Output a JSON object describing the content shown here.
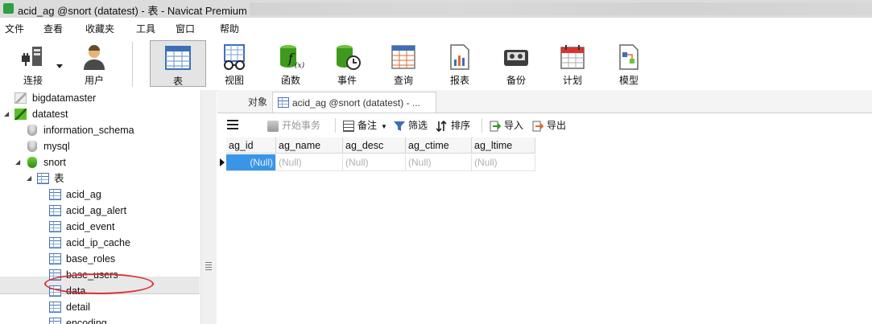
{
  "window": {
    "title": "acid_ag @snort (datatest) - 表 - Navicat Premium"
  },
  "menu": [
    "文件",
    "查看",
    "收藏夹",
    "工具",
    "窗口",
    "帮助"
  ],
  "toolbar": {
    "buttons": [
      {
        "label": "连接",
        "icon": "plug-icon"
      },
      {
        "label": "用户",
        "icon": "user-icon"
      },
      {
        "label": "表",
        "icon": "table-icon",
        "active": true
      },
      {
        "label": "视图",
        "icon": "view-icon"
      },
      {
        "label": "函数",
        "icon": "function-icon"
      },
      {
        "label": "事件",
        "icon": "event-icon"
      },
      {
        "label": "查询",
        "icon": "query-icon"
      },
      {
        "label": "报表",
        "icon": "report-icon"
      },
      {
        "label": "备份",
        "icon": "backup-icon"
      },
      {
        "label": "计划",
        "icon": "schedule-icon"
      },
      {
        "label": "模型",
        "icon": "model-icon"
      }
    ]
  },
  "sidebar": {
    "connections": [
      {
        "name": "bigdatamaster"
      },
      {
        "name": "datatest",
        "databases": [
          {
            "name": "information_schema"
          },
          {
            "name": "mysql"
          },
          {
            "name": "snort",
            "group": "表",
            "tables": [
              "acid_ag",
              "acid_ag_alert",
              "acid_event",
              "acid_ip_cache",
              "base_roles",
              "base_users",
              "data",
              "detail",
              "encoding"
            ]
          }
        ]
      }
    ],
    "selected": "acid_ag"
  },
  "tabs": [
    {
      "label": "对象"
    },
    {
      "label": "acid_ag @snort (datatest) - ..."
    }
  ],
  "data_toolbar": {
    "menu_icon": "hamburger-icon",
    "begin_transaction": "开始事务",
    "memo": "备注",
    "filter": "筛选",
    "sort": "排序",
    "import": "导入",
    "export": "导出"
  },
  "grid": {
    "columns": [
      "ag_id",
      "ag_name",
      "ag_desc",
      "ag_ctime",
      "ag_ltime"
    ],
    "rows": [
      [
        "(Null)",
        "(Null)",
        "(Null)",
        "(Null)",
        "(Null)"
      ]
    ]
  },
  "colors": {
    "accent": "#3b95e6",
    "annotation": "#d93030"
  }
}
